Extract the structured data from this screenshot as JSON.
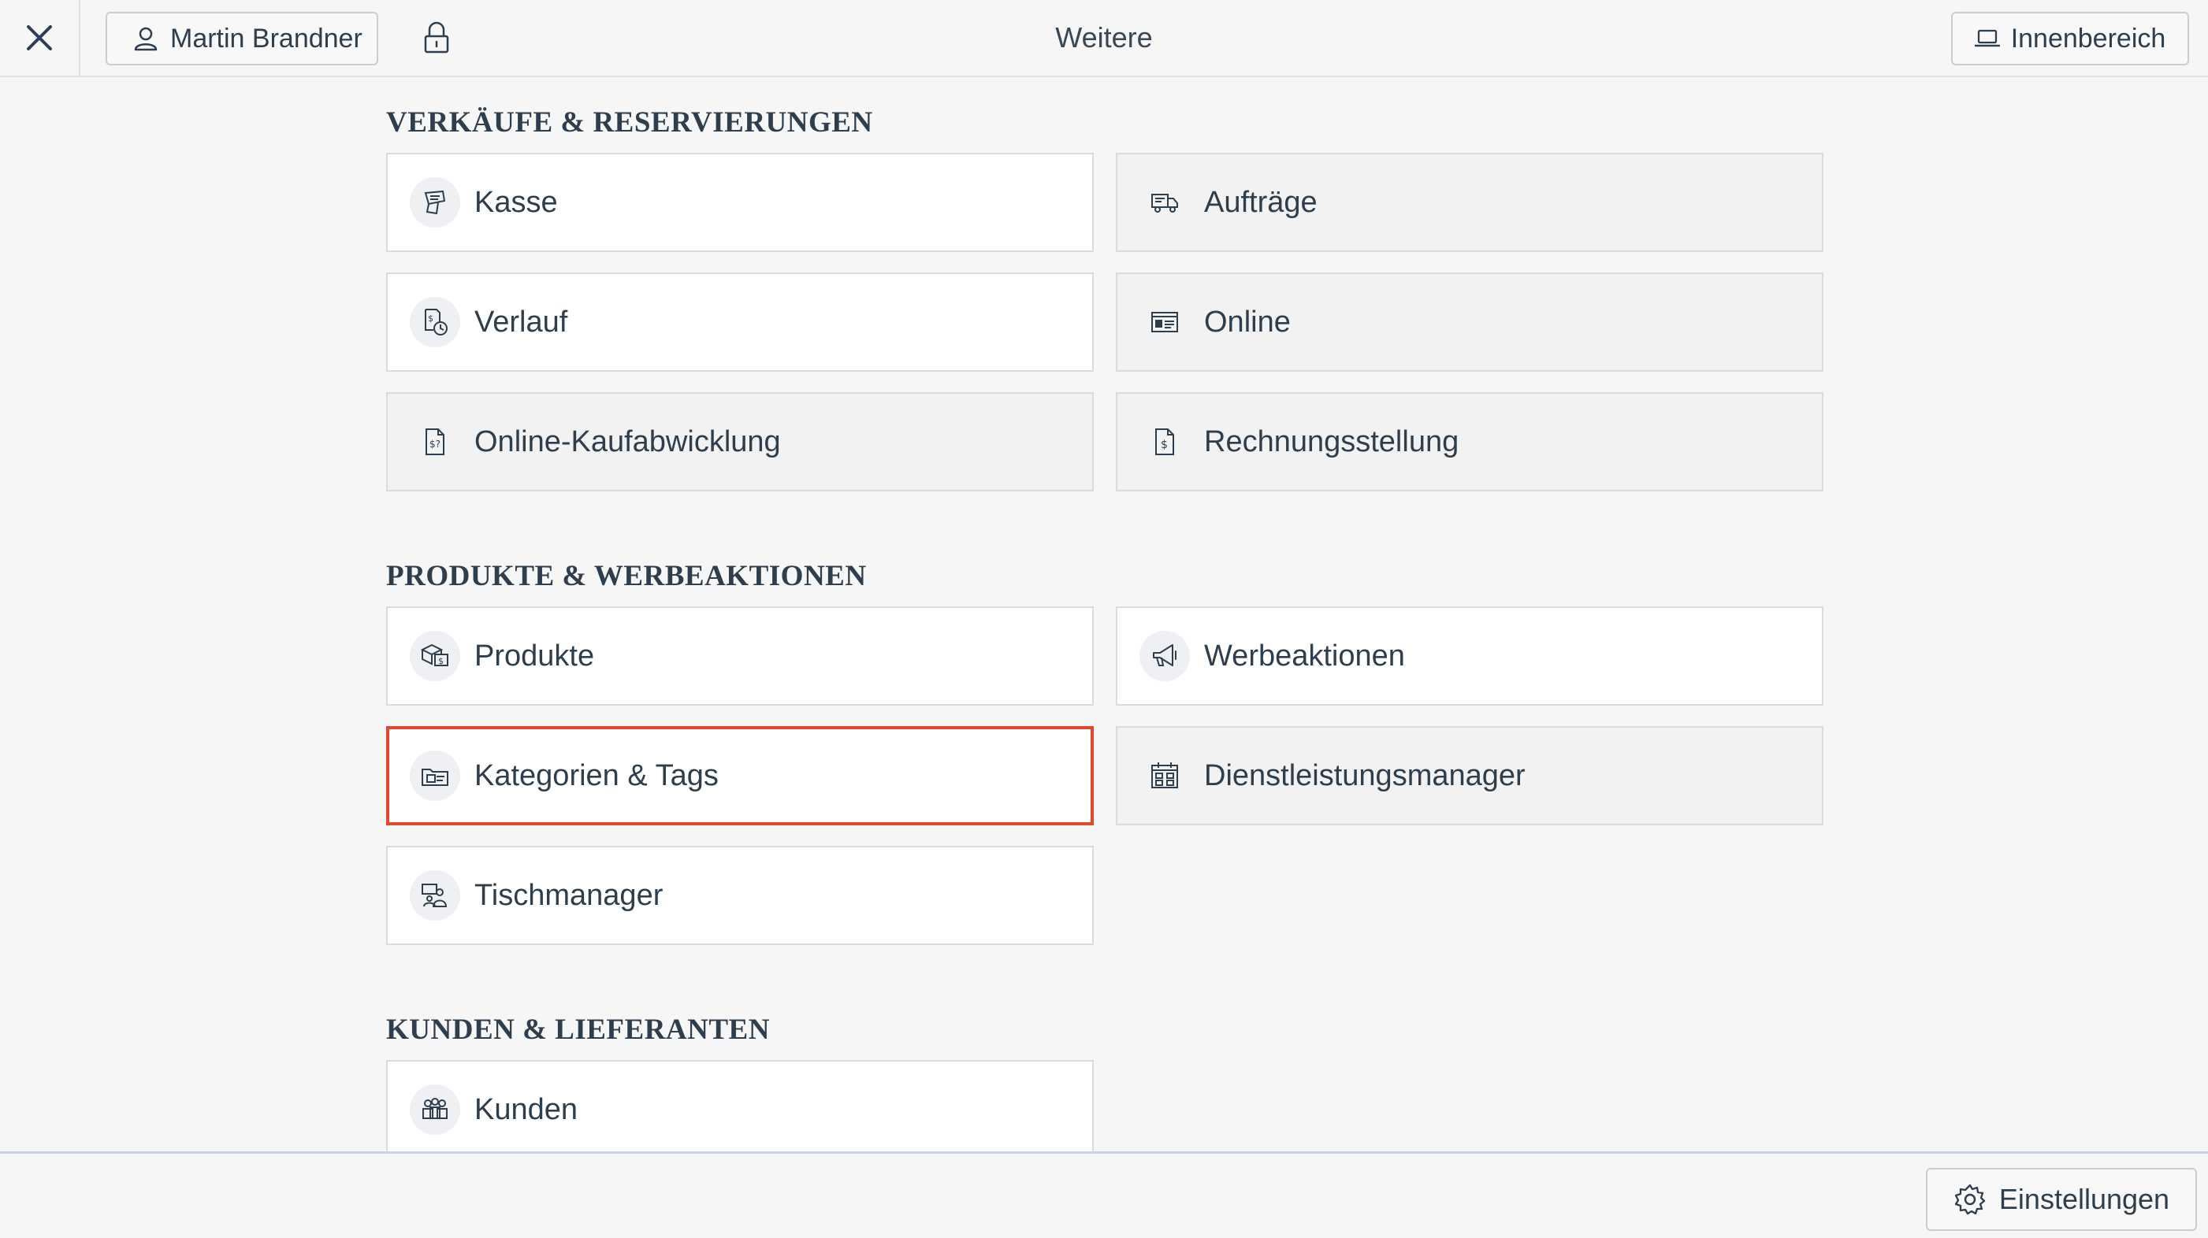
{
  "header": {
    "title": "Weitere",
    "user_label": "Martin Brandner",
    "inner_label": "Innenbereich"
  },
  "sections": [
    {
      "title": "VERKÄUFE & RESERVIERUNGEN",
      "tiles": [
        {
          "label": "Kasse",
          "icon": "cash-register-icon"
        },
        {
          "label": "Aufträge",
          "icon": "delivery-truck-icon"
        },
        {
          "label": "Verlauf",
          "icon": "history-receipt-icon"
        },
        {
          "label": "Online",
          "icon": "browser-window-icon"
        },
        {
          "label": "Online-Kaufabwicklung",
          "icon": "online-checkout-document-icon"
        },
        {
          "label": "Rechnungsstellung",
          "icon": "invoice-document-icon"
        }
      ]
    },
    {
      "title": "PRODUKTE & WERBEAKTIONEN",
      "tiles": [
        {
          "label": "Produkte",
          "icon": "products-box-icon"
        },
        {
          "label": "Werbeaktionen",
          "icon": "megaphone-icon"
        },
        {
          "label": "Kategorien & Tags",
          "icon": "folder-tag-icon",
          "selected": true
        },
        {
          "label": "Dienstleistungsmanager",
          "icon": "calendar-grid-icon"
        },
        {
          "label": "Tischmanager",
          "icon": "table-people-icon"
        }
      ]
    },
    {
      "title": "KUNDEN & LIEFERANTEN",
      "tiles": [
        {
          "label": "Kunden",
          "icon": "customers-group-icon"
        }
      ]
    }
  ],
  "footer": {
    "settings_label": "Einstellungen"
  },
  "colors": {
    "accent_selected": "#e04a2b",
    "text": "#2e3e4d",
    "background": "#f6f6f6"
  }
}
